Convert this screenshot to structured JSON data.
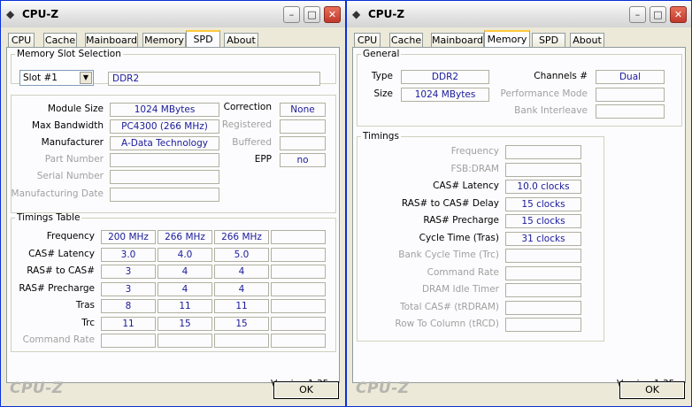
{
  "left_window": {
    "title": "CPU-Z",
    "tabs": [
      {
        "label": "CPU"
      },
      {
        "label": "Cache"
      },
      {
        "label": "Mainboard"
      },
      {
        "label": "Memory"
      },
      {
        "label": "SPD"
      },
      {
        "label": "About"
      }
    ],
    "active_tab": "SPD",
    "slot_selection": {
      "legend": "Memory Slot Selection",
      "selected": "Slot #1",
      "type_value": "DDR2"
    },
    "module": {
      "module_size_label": "Module Size",
      "module_size": "1024 MBytes",
      "max_bandwidth_label": "Max Bandwidth",
      "max_bandwidth": "PC4300 (266 MHz)",
      "manufacturer_label": "Manufacturer",
      "manufacturer": "A-Data Technology",
      "part_number_label": "Part Number",
      "part_number": "",
      "serial_number_label": "Serial Number",
      "serial_number": "",
      "mfg_date_label": "Manufacturing Date",
      "mfg_date": "",
      "correction_label": "Correction",
      "correction": "None",
      "registered_label": "Registered",
      "registered": "",
      "buffered_label": "Buffered",
      "buffered": "",
      "epp_label": "EPP",
      "epp": "no"
    },
    "timings_table": {
      "legend": "Timings Table",
      "rows": [
        {
          "label": "Frequency",
          "values": [
            "200 MHz",
            "266 MHz",
            "266 MHz",
            ""
          ]
        },
        {
          "label": "CAS# Latency",
          "values": [
            "3.0",
            "4.0",
            "5.0",
            ""
          ]
        },
        {
          "label": "RAS# to CAS#",
          "values": [
            "3",
            "4",
            "4",
            ""
          ]
        },
        {
          "label": "RAS# Precharge",
          "values": [
            "3",
            "4",
            "4",
            ""
          ]
        },
        {
          "label": "Tras",
          "values": [
            "8",
            "11",
            "11",
            ""
          ]
        },
        {
          "label": "Trc",
          "values": [
            "11",
            "15",
            "15",
            ""
          ]
        },
        {
          "label": "Command Rate",
          "values": [
            "",
            "",
            "",
            ""
          ]
        }
      ]
    },
    "version": "Version 1.35",
    "logo": "CPU-Z",
    "ok_label": "OK"
  },
  "right_window": {
    "title": "CPU-Z",
    "tabs": [
      {
        "label": "CPU"
      },
      {
        "label": "Cache"
      },
      {
        "label": "Mainboard"
      },
      {
        "label": "Memory"
      },
      {
        "label": "SPD"
      },
      {
        "label": "About"
      }
    ],
    "active_tab": "Memory",
    "general": {
      "legend": "General",
      "type_label": "Type",
      "type": "DDR2",
      "size_label": "Size",
      "size": "1024 MBytes",
      "channels_label": "Channels #",
      "channels": "Dual",
      "perf_mode_label": "Performance Mode",
      "perf_mode": "",
      "bank_interleave_label": "Bank Interleave",
      "bank_interleave": ""
    },
    "timings": {
      "legend": "Timings",
      "rows": [
        {
          "label": "Frequency",
          "value": "",
          "enabled": false
        },
        {
          "label": "FSB:DRAM",
          "value": "",
          "enabled": false
        },
        {
          "label": "CAS# Latency",
          "value": "10.0 clocks",
          "enabled": true
        },
        {
          "label": "RAS# to CAS# Delay",
          "value": "15 clocks",
          "enabled": true
        },
        {
          "label": "RAS# Precharge",
          "value": "15 clocks",
          "enabled": true
        },
        {
          "label": "Cycle Time (Tras)",
          "value": "31 clocks",
          "enabled": true
        },
        {
          "label": "Bank Cycle Time (Trc)",
          "value": "",
          "enabled": false
        },
        {
          "label": "Command Rate",
          "value": "",
          "enabled": false
        },
        {
          "label": "DRAM Idle Timer",
          "value": "",
          "enabled": false
        },
        {
          "label": "Total CAS# (tRDRAM)",
          "value": "",
          "enabled": false
        },
        {
          "label": "Row To Column (tRCD)",
          "value": "",
          "enabled": false
        }
      ]
    },
    "version": "Version 1.35",
    "logo": "CPU-Z",
    "ok_label": "OK"
  },
  "icons": {
    "app": "cpu-z-app-icon",
    "minimize": "minimize-icon",
    "maximize": "maximize-icon",
    "close": "close-icon",
    "dropdown": "chevron-down-icon"
  },
  "colors": {
    "value_text": "#1a1a9a",
    "window_bg": "#ece9d8",
    "panel_bg": "#fcfcfe",
    "active_tab_accent": "#ffc83c",
    "close_button": "#c0392b"
  }
}
